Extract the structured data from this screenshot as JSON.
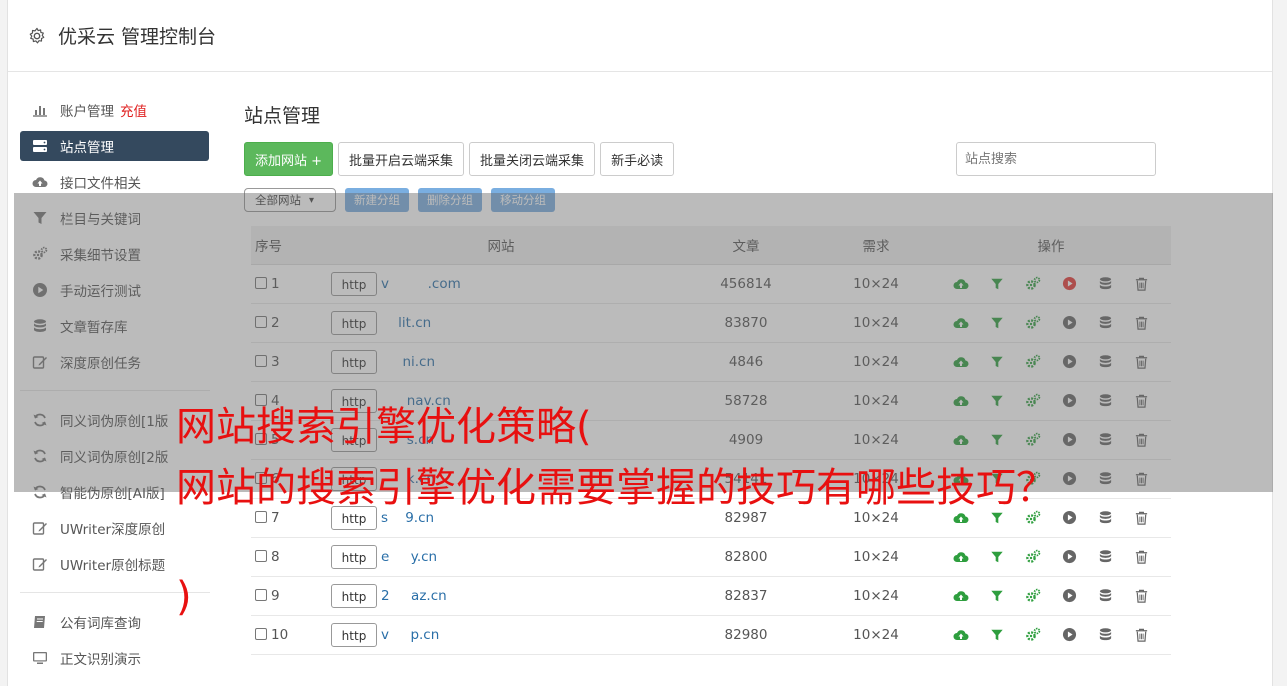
{
  "app": {
    "title": "优采云 管理控制台"
  },
  "sidebar": {
    "group1": [
      {
        "label": "账户管理",
        "highlight": "充值",
        "icon": "bar-chart-icon"
      },
      {
        "label": "站点管理",
        "icon": "server-icon",
        "active": true
      },
      {
        "label": "接口文件相关",
        "icon": "cloud-upload-icon"
      },
      {
        "label": "栏目与关键词",
        "icon": "filter-icon"
      },
      {
        "label": "采集细节设置",
        "icon": "cogs-icon"
      },
      {
        "label": "手动运行测试",
        "icon": "play-circle-icon"
      },
      {
        "label": "文章暂存库",
        "icon": "database-icon"
      },
      {
        "label": "深度原创任务",
        "icon": "edit-icon"
      }
    ],
    "group2": [
      {
        "label": "同义词伪原创[1版",
        "icon": "refresh-icon"
      },
      {
        "label": "同义词伪原创[2版",
        "icon": "refresh-icon"
      },
      {
        "label": "智能伪原创[AI版]",
        "icon": "refresh-icon"
      },
      {
        "label": "UWriter深度原创",
        "icon": "edit-icon"
      },
      {
        "label": "UWriter原创标题",
        "icon": "edit-icon"
      }
    ],
    "group3": [
      {
        "label": "公有词库查询",
        "icon": "book-icon"
      },
      {
        "label": "正文识别演示",
        "icon": "monitor-icon"
      }
    ]
  },
  "main": {
    "title": "站点管理",
    "toolbar": {
      "add": "添加网站 +",
      "enable": "批量开启云端采集",
      "disable": "批量关闭云端采集",
      "guide": "新手必读"
    },
    "search_placeholder": "站点搜索",
    "group_select": "全部网站",
    "group_buttons": {
      "new": "新建分组",
      "delete": "删除分组",
      "move": "移动分组"
    },
    "table": {
      "headers": {
        "no": "序号",
        "site": "网站",
        "articles": "文章",
        "demand": "需求",
        "ops": "操作"
      },
      "protocol": "http",
      "rows": [
        {
          "no": "1",
          "site": "v         .com",
          "articles": "456814",
          "demand": "10×24"
        },
        {
          "no": "2",
          "site": "    lit.cn",
          "articles": "83870",
          "demand": "10×24"
        },
        {
          "no": "3",
          "site": "     ni.cn",
          "articles": "4846",
          "demand": "10×24"
        },
        {
          "no": "4",
          "site": "      nav.cn",
          "articles": "58728",
          "demand": "10×24"
        },
        {
          "no": "5",
          "site": "      s.cn",
          "articles": "4909",
          "demand": "10×24"
        },
        {
          "no": "6",
          "site": "      k.cn",
          "articles": "54141",
          "demand": "10×24"
        },
        {
          "no": "7",
          "site": "s    9.cn",
          "articles": "82987",
          "demand": "10×24"
        },
        {
          "no": "8",
          "site": "e     y.cn",
          "articles": "82800",
          "demand": "10×24"
        },
        {
          "no": "9",
          "site": "2     az.cn",
          "articles": "82837",
          "demand": "10×24"
        },
        {
          "no": "10",
          "site": "v     p.cn",
          "articles": "82980",
          "demand": "10×24"
        }
      ]
    }
  },
  "overlay_text": {
    "line1": "网站搜索引擎优化策略(",
    "line2": "网站的搜索引擎优化需要掌握的技巧有哪些技巧？",
    "line3": ")"
  },
  "colors": {
    "sidebar_active": "#34495e",
    "add_button": "#5cb85c",
    "group_button": "#7aaee0",
    "link": "#2a6fa8",
    "headline": "#e81010",
    "upload_icon": "#2e9e3e",
    "play_active": "#e53935"
  }
}
